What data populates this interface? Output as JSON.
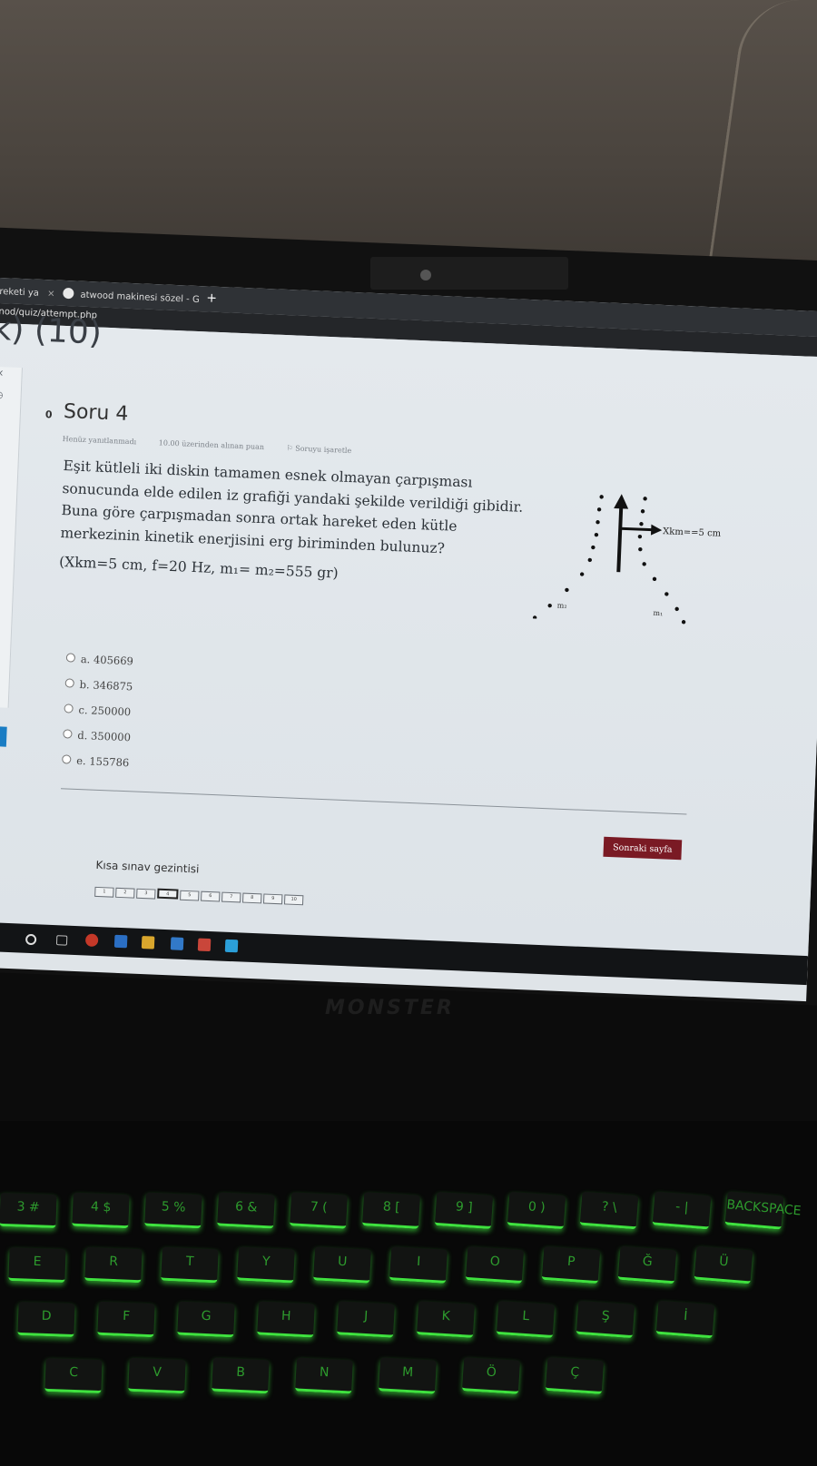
{
  "browser": {
    "tabs": [
      {
        "label": "reketi ya"
      },
      {
        "label": "atwood makinesi sözel - G"
      }
    ],
    "new_tab": "+",
    "close": "×",
    "url": "nod/quiz/attempt.php"
  },
  "page": {
    "heading_fragment": "k) (10)",
    "question_number": "0",
    "title": "Soru 4",
    "meta": {
      "status": "Henüz yanıtlanmadı",
      "points": "10.00 üzerinden alınan puan",
      "flag": "Soruyu işaretle"
    },
    "question_lines": [
      "Eşit kütleli iki diskin tamamen esnek olmayan çarpışması",
      "sonucunda elde edilen iz grafiği yandaki şekilde verildiği gibidir.",
      "Buna göre çarpışmadan sonra ortak hareket eden kütle",
      "merkezinin kinetik enerjisini erg biriminden bulunuz?"
    ],
    "params": "(Xkm=5 cm, f=20 Hz, m₁= m₂=555 gr)",
    "figure": {
      "arrow_label": "Xkm==5 cm",
      "m_left": "m₂",
      "m_right": "m₁"
    },
    "options": [
      {
        "label": "a. 405669"
      },
      {
        "label": "b. 346875"
      },
      {
        "label": "c. 250000"
      },
      {
        "label": "d. 350000"
      },
      {
        "label": "e. 155786"
      }
    ],
    "next_button": "Sonraki sayfa",
    "nav_title": "Kısa sınav gezintisi",
    "nav_pages": [
      "1",
      "2",
      "3",
      "4",
      "5",
      "6",
      "7",
      "8",
      "9",
      "10"
    ],
    "current_page": "4"
  },
  "keyboard": {
    "brand": "MONSTER",
    "keys_row1": [
      "3 #",
      "4 $",
      "5 %",
      "6 &",
      "7 (",
      "8 [",
      "9 ]",
      "0 )",
      "? \\",
      "- |",
      "BACKSPACE"
    ],
    "keys_row2": [
      "E",
      "R",
      "T",
      "Y",
      "U",
      "I",
      "O",
      "P",
      "Ğ",
      "Ü"
    ],
    "keys_row3": [
      "D",
      "F",
      "G",
      "H",
      "J",
      "K",
      "L",
      "Ş",
      "İ"
    ],
    "keys_row4": [
      "C",
      "V",
      "B",
      "N",
      "M",
      "Ö",
      "Ç"
    ]
  },
  "colors": {
    "next_button_bg": "#7a1a24",
    "active_sidebar": "#1a7dc4",
    "keyboard_glow": "#3fe23f"
  }
}
